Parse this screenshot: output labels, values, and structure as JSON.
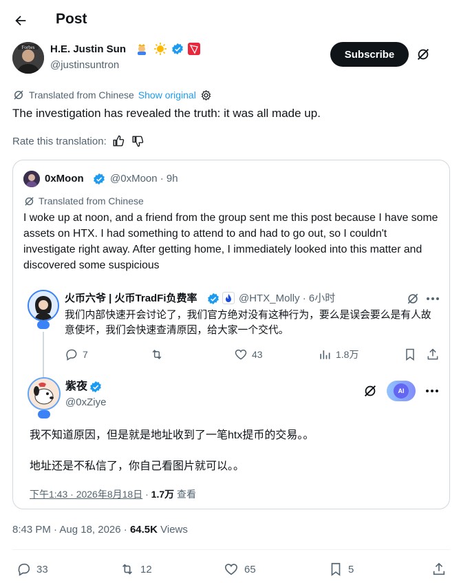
{
  "header": {
    "title": "Post"
  },
  "author": {
    "name": "H.E. Justin Sun",
    "handle": "@justinsuntron",
    "avatar_text": "Forbes"
  },
  "subscribe_label": "Subscribe",
  "translation": {
    "label": "Translated from Chinese",
    "show_original": "Show original"
  },
  "post_text": "The investigation has revealed the truth: it was all made up.",
  "rate_label": "Rate this translation:",
  "quote": {
    "name": "0xMoon",
    "handle_time": "@0xMoon · 9h",
    "translation_label": "Translated from Chinese",
    "text": "I woke up at noon, and a friend from the group sent me this post because I have some assets on HTX. I had something to attend to and had to go out, so I couldn't investigate right away. After getting home, I immediately looked into this matter and discovered some suspicious",
    "embedded": {
      "first": {
        "name": "火币六爷 | 火币TradFi负费率",
        "handle_time": "@HTX_Molly · 6小时",
        "text": "我们内部快速开会讨论了，我们官方绝对没有这种行为，要么是误会要么是有人故意使坏，我们会快速查清原因，给大家一个交代。",
        "replies": "7",
        "likes": "43",
        "views": "1.8万"
      },
      "second": {
        "name": "紫夜",
        "handle": "@0xZiye",
        "ai_label": "AI",
        "line1": "我不知道原因，但是就是地址收到了一笔htx提币的交易。。",
        "line2": "地址还是不私信了，你自己看图片就可以。。",
        "timestamp": "下午1:43 · 2026年8月18日",
        "views_count": "1.7万",
        "views_word": "查看"
      }
    }
  },
  "timestamp": {
    "time_date": "8:43 PM · Aug 18, 2026 · ",
    "views_count": "64.5K",
    "views_word": " Views"
  },
  "actions": {
    "replies": "33",
    "reposts": "12",
    "likes": "65",
    "bookmarks": "5"
  },
  "colors": {
    "accent": "#1d9bf0",
    "text": "#0f1419",
    "muted": "#536471",
    "border": "#cfd9de",
    "verified": "#1d9bf0"
  },
  "icons": [
    "back-arrow-icon",
    "prince-emoji-icon",
    "sun-emoji-icon",
    "verified-badge-icon",
    "tron-logo-icon",
    "grok-icon",
    "settings-icon",
    "thumbs-up-icon",
    "thumbs-down-icon",
    "reply-icon",
    "repost-icon",
    "like-icon",
    "views-icon",
    "bookmark-icon",
    "share-icon",
    "more-icon",
    "ai-icon"
  ]
}
